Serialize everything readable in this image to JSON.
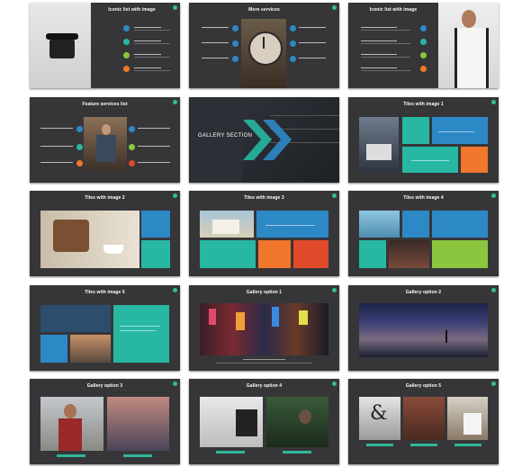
{
  "slides": [
    {
      "title": "Iconic list with image"
    },
    {
      "title": "More services"
    },
    {
      "title": "Iconic list with image"
    },
    {
      "title": "Feature services list"
    },
    {
      "title": "GALLERY SECTION"
    },
    {
      "title": "Tiles with image 1"
    },
    {
      "title": "Tiles with image 2"
    },
    {
      "title": "Tiles with image 3"
    },
    {
      "title": "Tiles with image 4"
    },
    {
      "title": "Tiles with image 5"
    },
    {
      "title": "Gallery option 1"
    },
    {
      "title": "Gallery option 2"
    },
    {
      "title": "Gallery option 3"
    },
    {
      "title": "Gallery option 4"
    },
    {
      "title": "Gallery option 5"
    }
  ],
  "colors": {
    "slide_bg": "#363638",
    "teal": "#27b7a3",
    "blue": "#2d88c6",
    "green": "#8cc63f",
    "orange": "#f0772b",
    "red": "#e04a2b",
    "accent_dot": "#30c08c"
  }
}
